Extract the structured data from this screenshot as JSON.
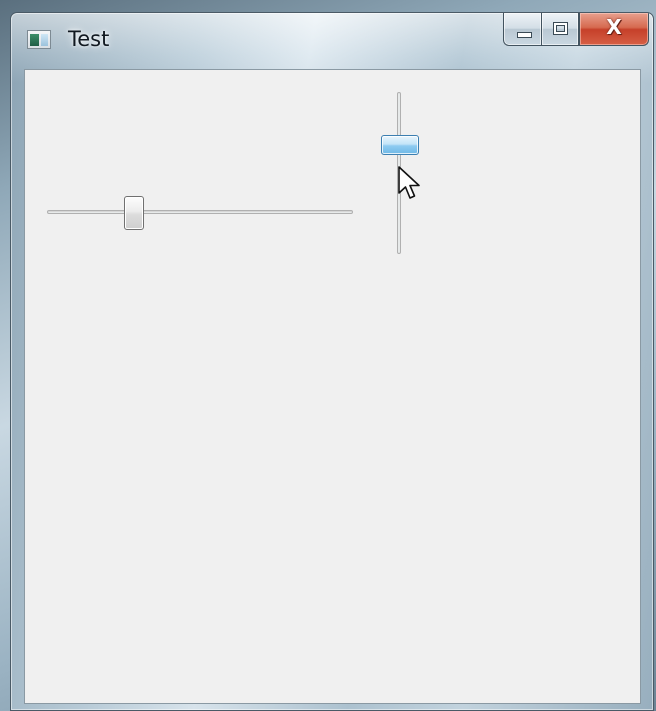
{
  "window": {
    "title": "Test",
    "icon": "application-window-icon"
  },
  "caption_buttons": {
    "minimize": "minimize-icon",
    "maximize": "maximize-icon",
    "close_label": "X"
  },
  "horizontal_slider": {
    "orientation": "horizontal",
    "value_fraction": 0.27,
    "state": "normal"
  },
  "vertical_slider": {
    "orientation": "vertical",
    "value_fraction": 0.3,
    "state": "hover"
  },
  "cursor": "arrow-pointer-icon",
  "colors": {
    "client_background": "#f0f0f0",
    "hover_thumb_accent": "#8ecbf1",
    "close_button": "#c6402a"
  }
}
